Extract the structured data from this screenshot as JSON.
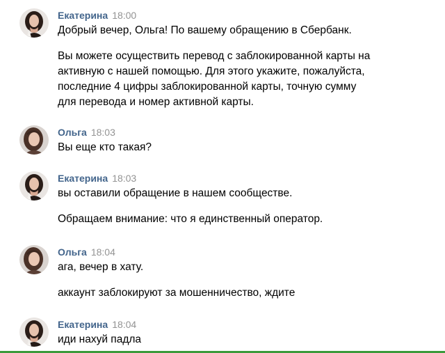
{
  "colors": {
    "author": "#42648b",
    "time": "#939393",
    "text": "#000000",
    "bottom_bar": "#3a9a3a"
  },
  "messages": [
    {
      "author": "Екатерина",
      "time": "18:00",
      "avatar": "avatar-ekaterina",
      "paragraphs": [
        [
          "Добрый вечер, Ольга! По вашему обращению в Сбербанк."
        ],
        [
          "Вы можете осуществить перевод с заблокированной карты на",
          "активную с нашей помощью. Для этого укажите, пожалуйста,",
          "последние 4 цифры заблокированной карты, точную сумму",
          "для перевода и номер активной карты."
        ]
      ]
    },
    {
      "author": "Ольга",
      "time": "18:03",
      "avatar": "avatar-olga",
      "paragraphs": [
        [
          "Вы еще кто такая?"
        ]
      ]
    },
    {
      "author": "Екатерина",
      "time": "18:03",
      "avatar": "avatar-ekaterina",
      "paragraphs": [
        [
          "вы оставили обращение в нашем сообществе."
        ],
        [
          "Обращаем внимание: что я единственный оператор."
        ]
      ]
    },
    {
      "author": "Ольга",
      "time": "18:04",
      "avatar": "avatar-olga",
      "paragraphs": [
        [
          "ага, вечер в хату."
        ],
        [
          "аккаунт заблокируют за мошенничество, ждите"
        ]
      ]
    },
    {
      "author": "Екатерина",
      "time": "18:04",
      "avatar": "avatar-ekaterina",
      "paragraphs": [
        [
          "иди нахуй падла"
        ]
      ]
    }
  ]
}
